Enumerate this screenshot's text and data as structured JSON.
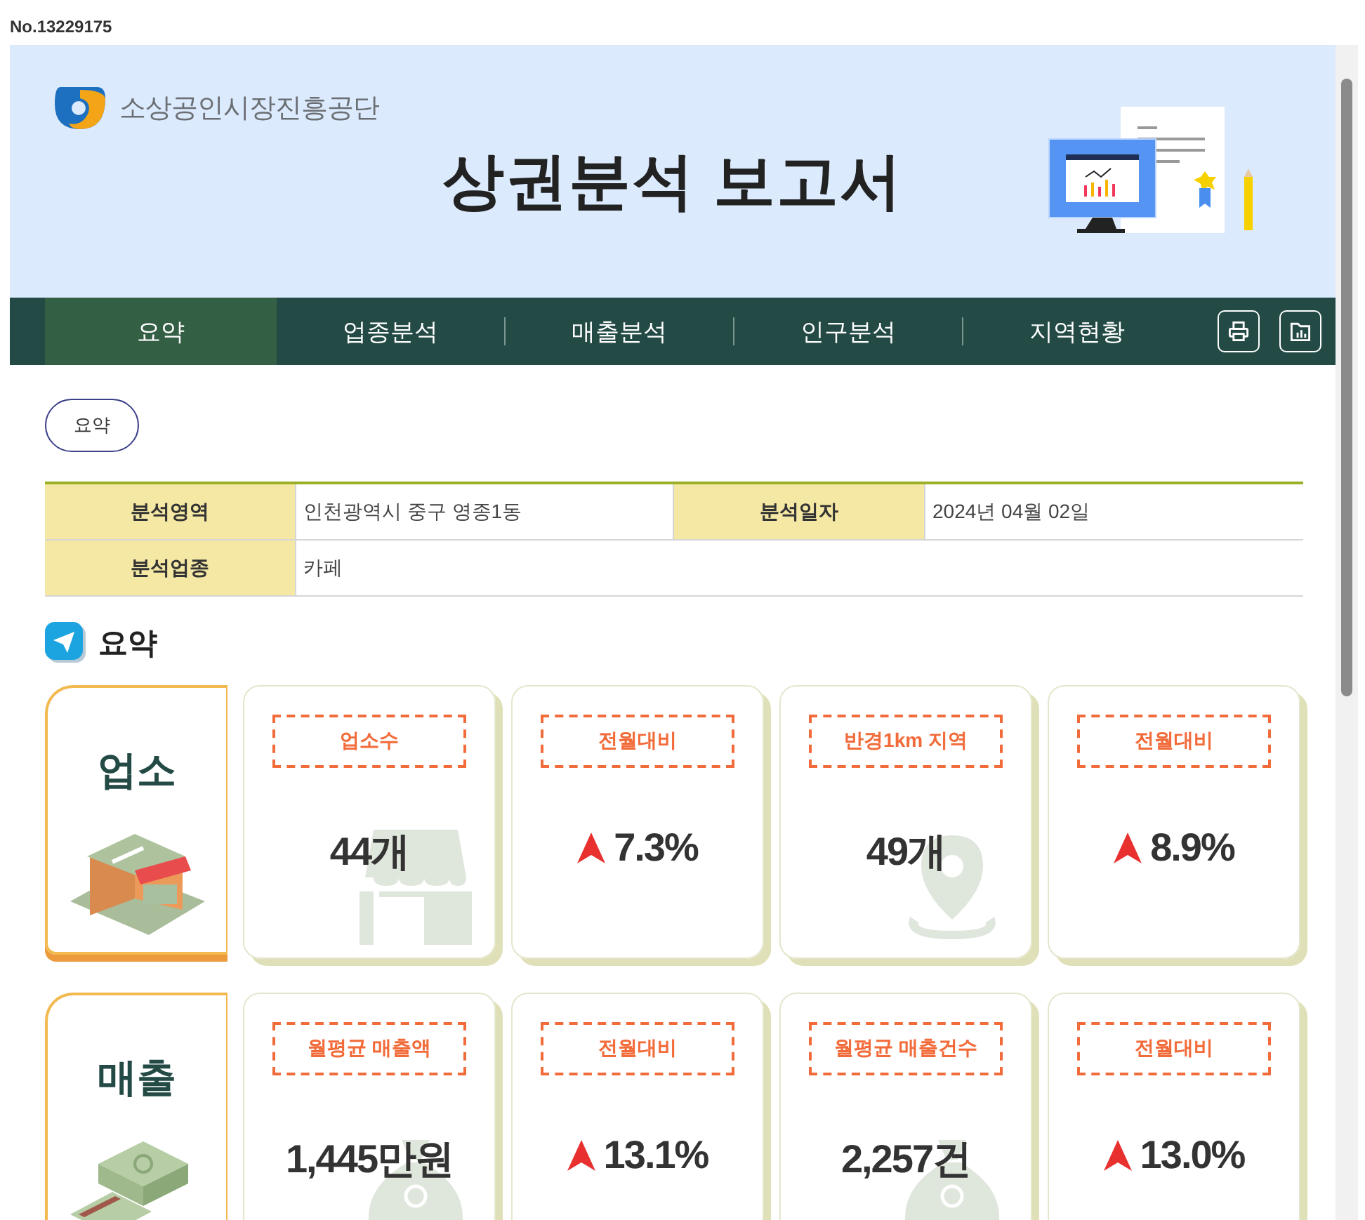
{
  "doc_no": "No.13229175",
  "header": {
    "org": "소상공인시장진흥공단",
    "title": "상권분석 보고서"
  },
  "tabs": [
    {
      "label": "요약",
      "selected": true
    },
    {
      "label": "업종분석",
      "selected": false
    },
    {
      "label": "매출분석",
      "selected": false
    },
    {
      "label": "인구분석",
      "selected": false
    },
    {
      "label": "지역현황",
      "selected": false
    }
  ],
  "summary_button": "요약",
  "info_table": [
    [
      {
        "label": "분석영역",
        "value": "인천광역시 중구 영종1동"
      },
      {
        "label": "분석일자",
        "value": "2024년 04월 02일"
      }
    ],
    [
      {
        "label": "분석업종",
        "value": "카페"
      }
    ]
  ],
  "section_title": "요약",
  "groups": [
    {
      "kind": "shop",
      "title": "업소",
      "cards": [
        {
          "kind": "shop",
          "label": "업소수",
          "value": "44개"
        },
        {
          "kind": "up",
          "label": "전월대비",
          "value": "7.3%"
        },
        {
          "kind": "pin",
          "label": "반경1km 지역",
          "value": "49개"
        },
        {
          "kind": "up",
          "label": "전월대비",
          "value": "8.9%"
        }
      ]
    },
    {
      "kind": "money",
      "title": "매출",
      "cards": [
        {
          "kind": "bag",
          "label": "월평균 매출액",
          "value": "1,445만원"
        },
        {
          "kind": "up",
          "label": "전월대비",
          "value": "13.1%"
        },
        {
          "kind": "bag",
          "label": "월평균 매출건수",
          "value": "2,257건"
        },
        {
          "kind": "up",
          "label": "전월대비",
          "value": "13.0%"
        }
      ]
    }
  ]
}
